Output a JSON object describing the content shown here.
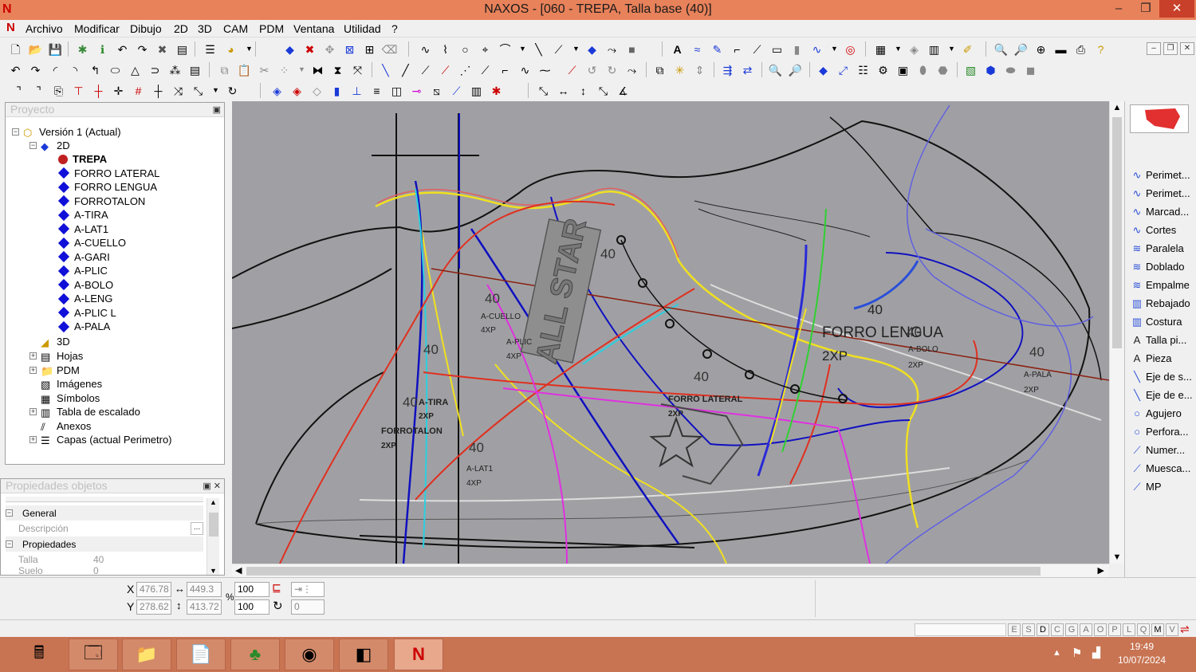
{
  "window": {
    "title": "NAXOS - [060 - TREPA, Talla base (40)]",
    "minimize": "–",
    "maximize": "❐",
    "close": "✕"
  },
  "menu": [
    "Archivo",
    "Modificar",
    "Dibujo",
    "2D",
    "3D",
    "CAM",
    "PDM",
    "Ventana",
    "Utilidad",
    "?"
  ],
  "project_panel": {
    "header": "Proyecto",
    "root": "Versión 1 (Actual)",
    "node_2d": "2D",
    "pieces": [
      "TREPA",
      "FORRO LATERAL",
      "FORRO LENGUA",
      "FORROTALON",
      "A-TIRA",
      "A-LAT1",
      "A-CUELLO",
      "A-GARI",
      "A-PLIC",
      "A-BOLO",
      "A-LENG",
      "A-PLIC L",
      "A-PALA"
    ],
    "others": [
      "3D",
      "Hojas",
      "PDM",
      "Imágenes",
      "Símbolos",
      "Tabla de escalado",
      "Anexos",
      "Capas (actual Perimetro)"
    ]
  },
  "properties_panel": {
    "header": "Propiedades objetos",
    "group_general": "General",
    "desc_label": "Descripción",
    "desc_button": "...",
    "group_props": "Propiedades",
    "talla_label": "Talla",
    "talla_value": "40",
    "suelo_label": "Suelo",
    "suelo_value": "0"
  },
  "coords": {
    "x_label": "X",
    "y_label": "Y",
    "x": "476.78",
    "y": "278.62",
    "w": "449.3",
    "h": "413.72",
    "pct_label": "%",
    "scale_x": "100",
    "scale_y": "100",
    "rotation": "0"
  },
  "status_flags": [
    "E",
    "S",
    "D",
    "C",
    "G",
    "A",
    "O",
    "P",
    "L",
    "Q",
    "M",
    "V"
  ],
  "right_tools": [
    "Perimet...",
    "Perimet...",
    "Marcad...",
    "Cortes",
    "Paralela",
    "Doblado",
    "Empalme",
    "Rebajado",
    "Costura",
    "Talla pi...",
    "Pieza",
    "Eje de s...",
    "Eje de e...",
    "Agujero",
    "Perfora...",
    "Numer...",
    "Muesca...",
    "MP"
  ],
  "canvas_labels": {
    "forro_lengua": "FORRO LENGUA",
    "forro_lateral": "FORRO LATERAL",
    "forrotalon": "FORROTALON",
    "a_cuello": "A-CUELLO",
    "a_plic": "A-PLIC",
    "a_tira": "A-TIRA",
    "a_lat1": "A-LAT1",
    "a_bolo": "A-BOLO",
    "a_pala": "A-PALA",
    "size40": "40",
    "x2": "2XP",
    "x4": "4XP",
    "brand": "ALL STAR"
  },
  "taskbar": {
    "time": "19:49",
    "date": "10/07/2024"
  }
}
